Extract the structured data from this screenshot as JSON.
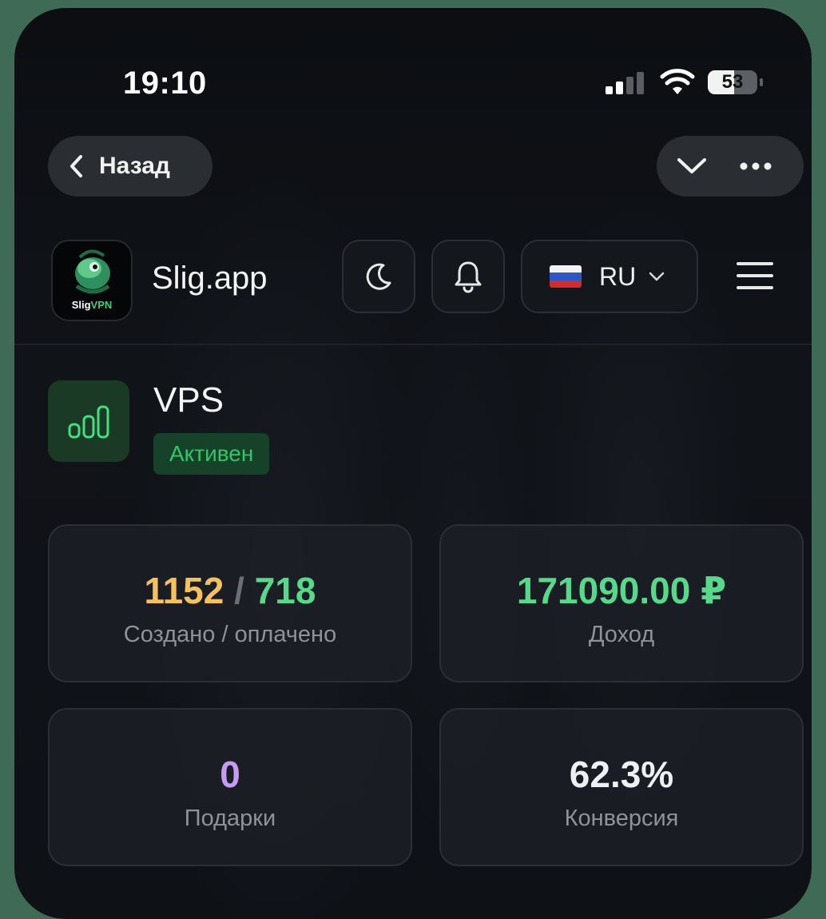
{
  "status_bar": {
    "time": "19:10",
    "battery_percent": "53",
    "battery_level": 0.53,
    "signal_bars_active": 2,
    "signal_bars_total": 4
  },
  "nav": {
    "back_label": "Назад"
  },
  "app": {
    "name": "Slig.app",
    "logo_brand_a": "Slig",
    "logo_brand_b": "VPN",
    "language": "RU"
  },
  "service": {
    "title": "VPS",
    "status": "Активен"
  },
  "stats": {
    "created": "1152",
    "separator": "/",
    "paid": "718",
    "created_paid_label": "Создано / оплачено",
    "income": "171090.00 ₽",
    "income_label": "Доход",
    "gifts": "0",
    "gifts_label": "Подарки",
    "conversion": "62.3%",
    "conversion_label": "Конверсия"
  },
  "colors": {
    "accent_green": "#56d98a",
    "created_yellow": "#f5c15c",
    "gifts_purple": "#c79bf2",
    "badge_bg": "#17422a"
  },
  "icons": [
    "chevron-left-icon",
    "chevron-down-icon",
    "more-dots-icon",
    "moon-icon",
    "bell-icon",
    "russia-flag-icon",
    "hamburger-icon",
    "bar-chart-icon",
    "signal-icon",
    "wifi-icon",
    "battery-icon"
  ]
}
